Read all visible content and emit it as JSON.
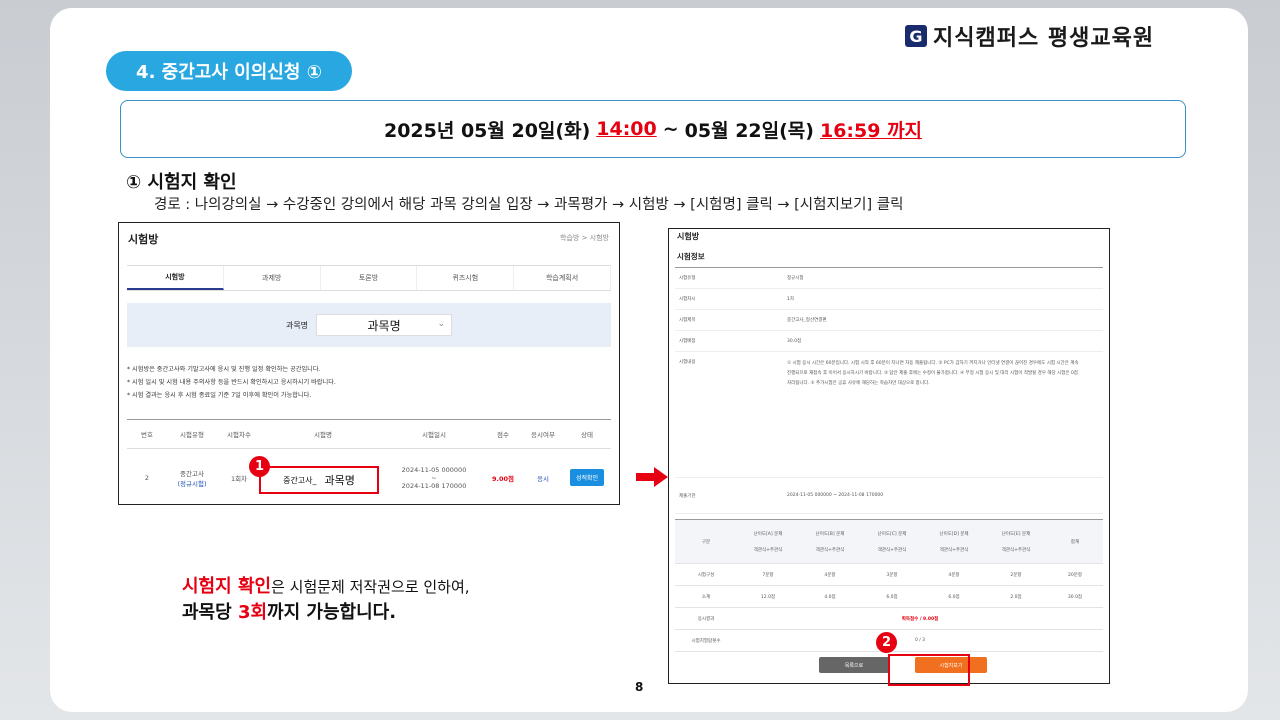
{
  "brand": {
    "mark": "G",
    "name": "지식캠퍼스 평생교육원"
  },
  "section": {
    "title": "4. 중간고사 이의신청 ①"
  },
  "period": {
    "start": "2025년 05월 20일(화)",
    "start_time": "14:00",
    "separator": "~",
    "end": "05월 22일(목)",
    "end_time": "16:59 까지"
  },
  "step": {
    "title": "① 시험지 확인",
    "path": "경로 : 나의강의실 → 수강중인 강의에서 해당 과목 강의실 입장 → 과목평가 → 시험방 →  [시험명] 클릭 → [시험지보기] 클릭"
  },
  "shot1": {
    "title": "시험방",
    "breadcrumb": "학습방 > 시험방",
    "tabs": [
      "시험방",
      "과제방",
      "토론방",
      "퀴즈시험",
      "학습계획서"
    ],
    "filter_label": "과목명",
    "filter_value": "과목명",
    "notes": [
      "* 시험방은 중간고사와 기말고사에 응시 및 진행 일정 확인하는 공간입니다.",
      "* 시험 일시 및 시험 내용 주의사항 등을 반드시 확인하시고 응시하시기 바랍니다.",
      "* 시험 결과는 응시 후 시험 종료일 기준 7일 이후에 확인이 가능합니다."
    ],
    "headers": [
      "번호",
      "시험유형",
      "시험차수",
      "시험명",
      "시험일시",
      "점수",
      "응시여부",
      "상태"
    ],
    "row": {
      "no": "2",
      "type": "중간고사",
      "type_sub": "(정규시험)",
      "round": "1회차",
      "name_prefix": "중간고사_",
      "name": "과목명",
      "date_start": "2024-11-05 000000",
      "date_sep": "~",
      "date_end": "2024-11-08 170000",
      "score": "9.00점",
      "status": "응시",
      "action": "성적확인"
    },
    "badge": "1"
  },
  "note": {
    "highlight": "시험지 확인",
    "rest": "은 시험문제 저작권으로 인하여,",
    "line2_a": "과목당 ",
    "line2_b": "3회",
    "line2_c": "까지 가능합니다."
  },
  "shot2": {
    "title": "시험방",
    "subtitle": "시험정보",
    "info": [
      {
        "k": "시험유형",
        "v": "정규시험"
      },
      {
        "k": "시험차시",
        "v": "1차"
      },
      {
        "k": "시험제목",
        "v": "중간고사_정산연결편"
      },
      {
        "k": "시험배점",
        "v": "30.0점"
      },
      {
        "k": "시험내용",
        "v": "① 시험 응시 시간은 60분입니다. 시험 시작 후 60분이 지나면 자동 제출됩니다. ② PC가 갑자기 꺼지거나 인터넷 연결이 끊어진 경우에도 시험 시간은 계속 진행되므로 재접속 후 이어서 응시하시기 바랍니다. ③ 답안 제출 후에는 수정이 불가합니다. ④ 부정 시험 응시 및 대리 시험이 적발될 경우 해당 시험은 0점 처리됩니다. ⑤ 추가시험은 공휴 사유에 해당하는 학습자만 대상으로 합니다."
      },
      {
        "k": "제출기한",
        "v": "2024-11-05 000000 ~ 2024-11-08 170000"
      }
    ],
    "grid_header1": [
      "구분",
      "난이도[A] 문제",
      "난이도[B] 문제",
      "난이도[C] 문제",
      "난이도[D] 문제",
      "난이도[E] 문제",
      "합계"
    ],
    "grid_header2": [
      "객관식+주관식",
      "객관식+주관식",
      "객관식+주관식",
      "객관식+주관식",
      "객관식+주관식"
    ],
    "grid_rows": [
      {
        "label": "시험구성",
        "cells": [
          "7문항",
          "4문항",
          "3문항",
          "4문항",
          "2문항"
        ],
        "total": "20문항"
      },
      {
        "label": "소계",
        "cells": [
          "12.0점",
          "4.0점",
          "6.0점",
          "6.0점",
          "2.0점"
        ],
        "total": "30.0점"
      }
    ],
    "result_label": "응시결과",
    "result_value": "획득점수 / 9.00점",
    "count_label": "시험지열람횟수",
    "count_value": "0 / 3",
    "btn_list": "목록으로",
    "btn_view": "시험지보기",
    "badge": "2"
  },
  "page_number": "8",
  "colors": {
    "accent": "#29a7e1",
    "highlight": "#e60012",
    "brand": "#1a2b6d",
    "action": "#f07020"
  }
}
